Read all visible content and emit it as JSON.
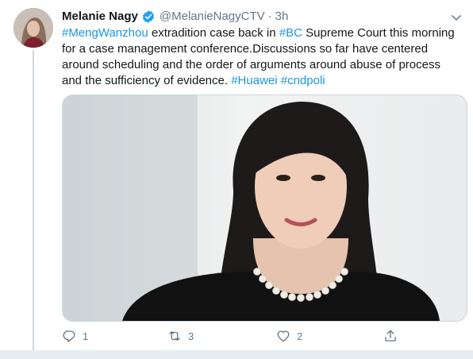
{
  "tweet": {
    "display_name": "Melanie Nagy",
    "verified_icon": "verified-badge-icon",
    "handle": "@MelanieNagyCTV",
    "separator": "·",
    "timestamp": "3h",
    "text_segments": [
      {
        "text": "#MengWanzhou",
        "hashtag": true
      },
      {
        "text": " extradition case back in ",
        "hashtag": false
      },
      {
        "text": "#BC",
        "hashtag": true
      },
      {
        "text": " Supreme Court this morning for a case management conference.Discussions so far have centered around scheduling and the order of arguments around abuse of process and the sufficiency of evidence. ",
        "hashtag": false
      },
      {
        "text": "#Huawei",
        "hashtag": true
      },
      {
        "text": " ",
        "hashtag": false
      },
      {
        "text": "#cndpoli",
        "hashtag": true
      }
    ],
    "actions": {
      "reply_count": "1",
      "retweet_count": "3",
      "like_count": "2"
    }
  },
  "colors": {
    "hashtag": "#1b95e0",
    "secondary_text": "#657786",
    "verified": "#1da1f2",
    "thread_line": "#ccd6dd"
  },
  "icons": [
    "caret-down-icon",
    "reply-icon",
    "retweet-icon",
    "like-icon",
    "share-icon"
  ]
}
